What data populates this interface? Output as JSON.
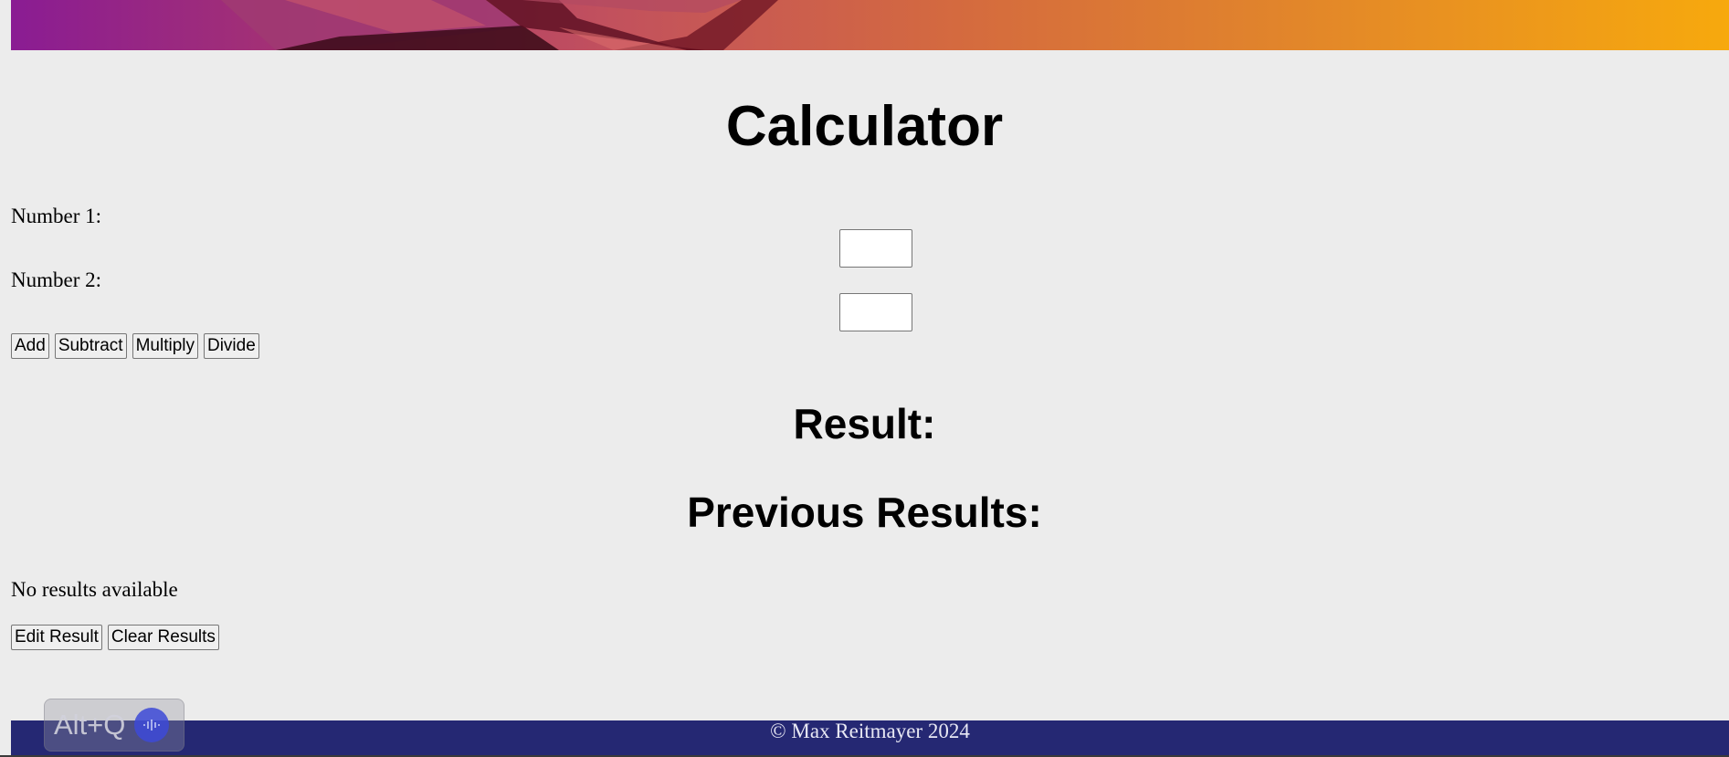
{
  "header": {
    "title": "Calculator"
  },
  "form": {
    "number1_label": "Number 1:",
    "number1_value": "",
    "number2_label": "Number 2:",
    "number2_value": ""
  },
  "operations": {
    "add": "Add",
    "subtract": "Subtract",
    "multiply": "Multiply",
    "divide": "Divide"
  },
  "result": {
    "heading": "Result:"
  },
  "history": {
    "heading": "Previous Results:",
    "empty_text": "No results available",
    "edit_label": "Edit Result",
    "clear_label": "Clear Results"
  },
  "footer": {
    "text": "© Max Reitmayer 2024"
  },
  "overlay": {
    "shortcut": "Alt+Q",
    "icon": "audio-wave-icon"
  },
  "colors": {
    "background": "#ececec",
    "footer": "#252873",
    "banner_start": "#8a1c93",
    "banner_end": "#f7a90d"
  }
}
